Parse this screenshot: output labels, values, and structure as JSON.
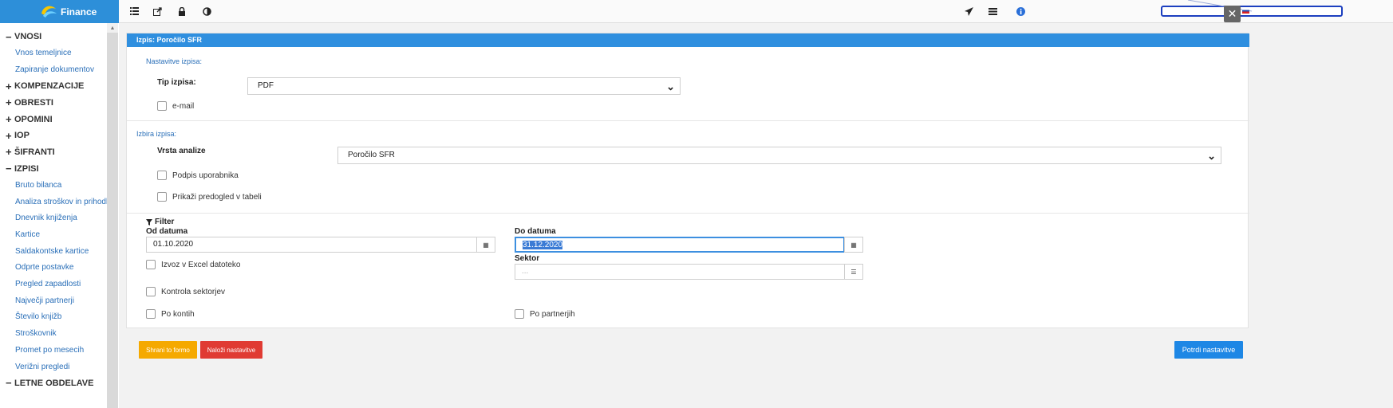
{
  "brand": {
    "title": "Finance"
  },
  "toolbar": {
    "left_icons": [
      "list-icon",
      "external-link-icon",
      "lock-icon",
      "contrast-icon"
    ],
    "right_icons": [
      "send-icon",
      "menu-lines-icon",
      "info-icon"
    ],
    "search_value": "",
    "close_label": "✕"
  },
  "sidebar": {
    "items": [
      {
        "type": "group",
        "sign": "−",
        "label": "VNOSI"
      },
      {
        "type": "link",
        "label": "Vnos temeljnice"
      },
      {
        "type": "link",
        "label": "Zapiranje dokumentov"
      },
      {
        "type": "group",
        "sign": "+",
        "label": "KOMPENZACIJE"
      },
      {
        "type": "group",
        "sign": "+",
        "label": "OBRESTI"
      },
      {
        "type": "group",
        "sign": "+",
        "label": "OPOMINI"
      },
      {
        "type": "group",
        "sign": "+",
        "label": "IOP"
      },
      {
        "type": "group",
        "sign": "+",
        "label": "ŠIFRANTI"
      },
      {
        "type": "group",
        "sign": "−",
        "label": "IZPISI"
      },
      {
        "type": "link",
        "label": "Bruto bilanca"
      },
      {
        "type": "link",
        "label": "Analiza stroškov in prihodk"
      },
      {
        "type": "link",
        "label": "Dnevnik knjiženja"
      },
      {
        "type": "link",
        "label": "Kartice"
      },
      {
        "type": "link",
        "label": "Saldakontske kartice"
      },
      {
        "type": "link",
        "label": "Odprte postavke"
      },
      {
        "type": "link",
        "label": "Pregled zapadlosti"
      },
      {
        "type": "link",
        "label": "Največji partnerji"
      },
      {
        "type": "link",
        "label": "Število knjižb"
      },
      {
        "type": "link",
        "label": "Stroškovnik"
      },
      {
        "type": "link",
        "label": "Promet po mesecih"
      },
      {
        "type": "link",
        "label": "Verižni pregledi"
      },
      {
        "type": "group",
        "sign": "−",
        "label": "LETNE OBDELAVE"
      }
    ]
  },
  "panel": {
    "title": "Izpis: Poročilo SFR",
    "settings": {
      "section_label": "Nastavitve izpisa:",
      "type_label": "Tip izpisa:",
      "type_value": "PDF",
      "email_label": "e-mail"
    },
    "selection": {
      "section_label": "Izbira izpisa:",
      "analysis_label": "Vrsta analize",
      "analysis_value": "Poročilo SFR",
      "signature_label": "Podpis uporabnika",
      "preview_label": "Prikaži predogled v tabeli"
    },
    "filter": {
      "title": "Filter",
      "from_label": "Od datuma",
      "from_value": "01.10.2020",
      "to_label": "Do datuma",
      "to_value": "31.12.2020",
      "sector_label": "Sektor",
      "sector_placeholder": "...",
      "excel_label": "Izvoz v Excel datoteko",
      "sector_check_label": "Kontrola sektorjev",
      "by_account_label": "Po kontih",
      "by_partner_label": "Po partnerjih"
    }
  },
  "footer": {
    "save_form": "Shrani to formo",
    "load_settings": "Naloži nastavitve",
    "confirm_settings": "Potrdi nastavitve"
  }
}
